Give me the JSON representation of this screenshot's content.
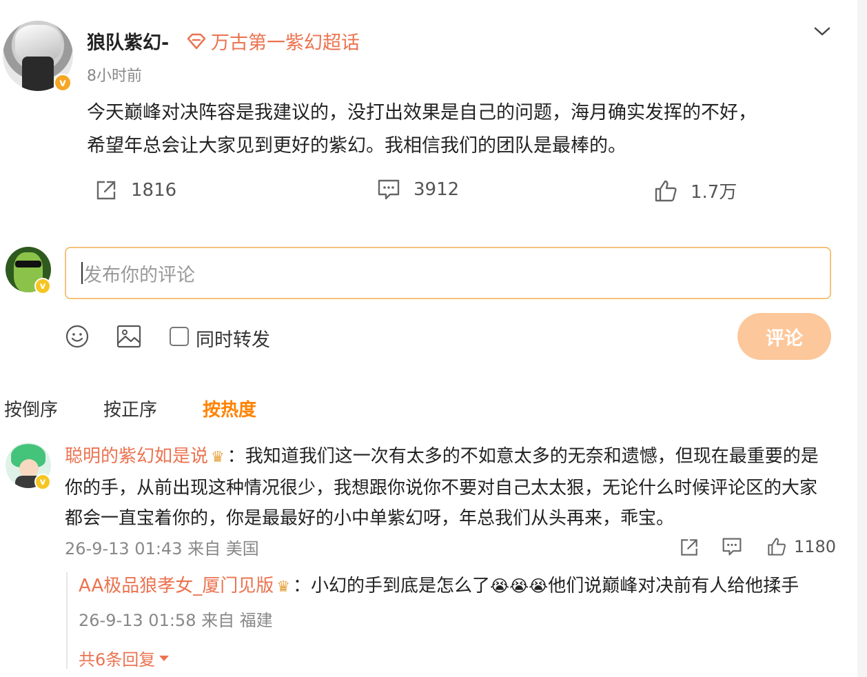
{
  "post": {
    "username": "狼队紫幻-",
    "supertopic": "万古第一紫幻超话",
    "time": "8小时前",
    "text_line1": "今天巅峰对决阵容是我建议的，没打出效果是自己的问题，海月确实发挥的不好，",
    "text_line2": "希望年总会让大家见到更好的紫幻。我相信我们的团队是最棒的。",
    "reposts": "1816",
    "comments": "3912",
    "likes": "1.7万"
  },
  "composer": {
    "placeholder": "发布你的评论",
    "repost_label": "同时转发",
    "submit_label": "评论"
  },
  "sort": {
    "tab_reverse": "按倒序",
    "tab_forward": "按正序",
    "tab_hot": "按热度"
  },
  "comment": {
    "user": "聪明的紫幻如是说",
    "text": "：我知道我们这一次有太多的不如意太多的无奈和遗憾，但现在最重要的是你的手，从前出现这种情况很少，我想跟你说你不要对自己太太狠，无论什么时候评论区的大家都会一直宝着你的，你是最最好的小中单紫幻呀，年总我们从头再来，乖宝。",
    "meta": "26-9-13 01:43 来自 美国",
    "likes": "1180"
  },
  "reply": {
    "user": "AA极品狼孝女_厦门见版",
    "text_a": "：小幻的手到底是怎么了",
    "emoji": "😭",
    "text_b": "他们说巅峰对决前有人给他揉手",
    "meta": "26-9-13 01:58 来自 福建",
    "more": "共6条回复"
  },
  "colors": {
    "accent": "#ff8200",
    "username": "#eb7350",
    "input_border": "#f6c27c",
    "button_bg": "#fcc79a"
  }
}
